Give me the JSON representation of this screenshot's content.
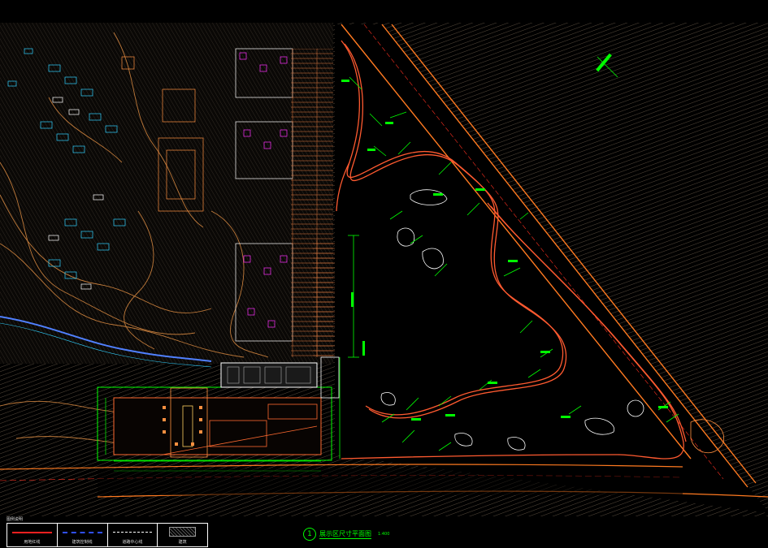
{
  "drawing": {
    "title": "展示区尺寸平面图",
    "scale": "1:400",
    "number": "1"
  },
  "legend": {
    "label": "图例说明",
    "items": [
      {
        "label": "用地红线",
        "color": "#ff2020",
        "style": "solid"
      },
      {
        "label": "建筑控制线",
        "color": "#3050ff",
        "style": "dashed"
      },
      {
        "label": "道路中心线",
        "color": "#ffffff",
        "style": "dashdot"
      },
      {
        "label": "建筑",
        "color": "#999999",
        "style": "hatch"
      }
    ]
  },
  "colors": {
    "background": "#000000",
    "hatch": "#7a6a58",
    "road": "#ff7a20",
    "path": "#ff5a30",
    "dimension": "#00ff00",
    "building": "#ffffff",
    "accent_magenta": "#ff30ff",
    "accent_cyan": "#30d0ff"
  }
}
